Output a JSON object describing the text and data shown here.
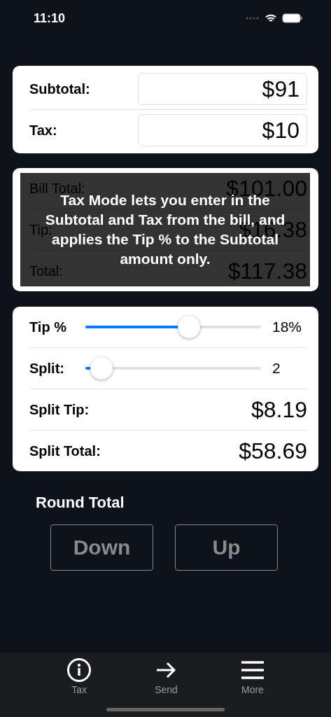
{
  "status_bar": {
    "time": "11:10"
  },
  "inputs": [
    {
      "label": "Subtotal:",
      "value": "$91"
    },
    {
      "label": "Tax:",
      "value": "$10"
    }
  ],
  "totals": [
    {
      "label": "Bill Total:",
      "value": "$101.00"
    },
    {
      "label": "Tip:",
      "value": "$16.38"
    },
    {
      "label": "Total:",
      "value": "$117.38"
    }
  ],
  "overlay": {
    "message": "Tax Mode lets you enter in the Subtotal and Tax from the bill, and applies the Tip % to the Subtotal amount only."
  },
  "controls": [
    {
      "kind": "slider",
      "label": "Tip %",
      "level": 0.59,
      "reading": "18%"
    },
    {
      "kind": "slider",
      "label": "Split:",
      "level": 0.09,
      "reading": "2"
    },
    {
      "kind": "result",
      "label": "Split Tip:",
      "value": "$8.19"
    },
    {
      "kind": "result",
      "label": "Split Total:",
      "value": "$58.69"
    }
  ],
  "round": {
    "title": "Round Total",
    "buttons": [
      {
        "label": "Down",
        "disabled": true
      },
      {
        "label": "Up",
        "disabled": true
      }
    ]
  },
  "tab_bar": [
    {
      "kind": "info",
      "label": "Tax"
    },
    {
      "kind": "arrow",
      "label": "Send"
    },
    {
      "kind": "menu",
      "label": "More"
    }
  ]
}
